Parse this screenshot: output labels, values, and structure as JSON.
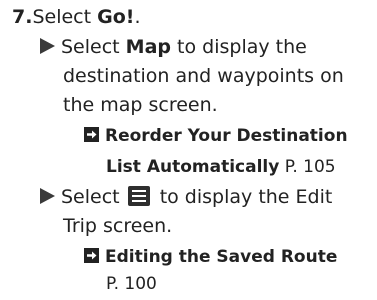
{
  "step": {
    "number": "7.",
    "text_before": "Select ",
    "go_label": "Go!",
    "text_after": "."
  },
  "bullet1": {
    "select": "Select ",
    "map_label": "Map",
    "text_after_map": " to display the",
    "line2": "destination and waypoints on",
    "line3": "the map screen."
  },
  "ref1": {
    "title_line1": "Reorder Your Destination",
    "title_line2": "List Automatically",
    "page": " P. 105"
  },
  "bullet2": {
    "select": "Select ",
    "text_after_icon": " to display the Edit",
    "line2": "Trip screen."
  },
  "ref2": {
    "title": "Editing the Saved Route",
    "page": "P. 100"
  },
  "icons": {
    "bullet": "play-triangle-icon",
    "reference": "cross-reference-arrow-icon",
    "menu": "menu-list-icon"
  }
}
